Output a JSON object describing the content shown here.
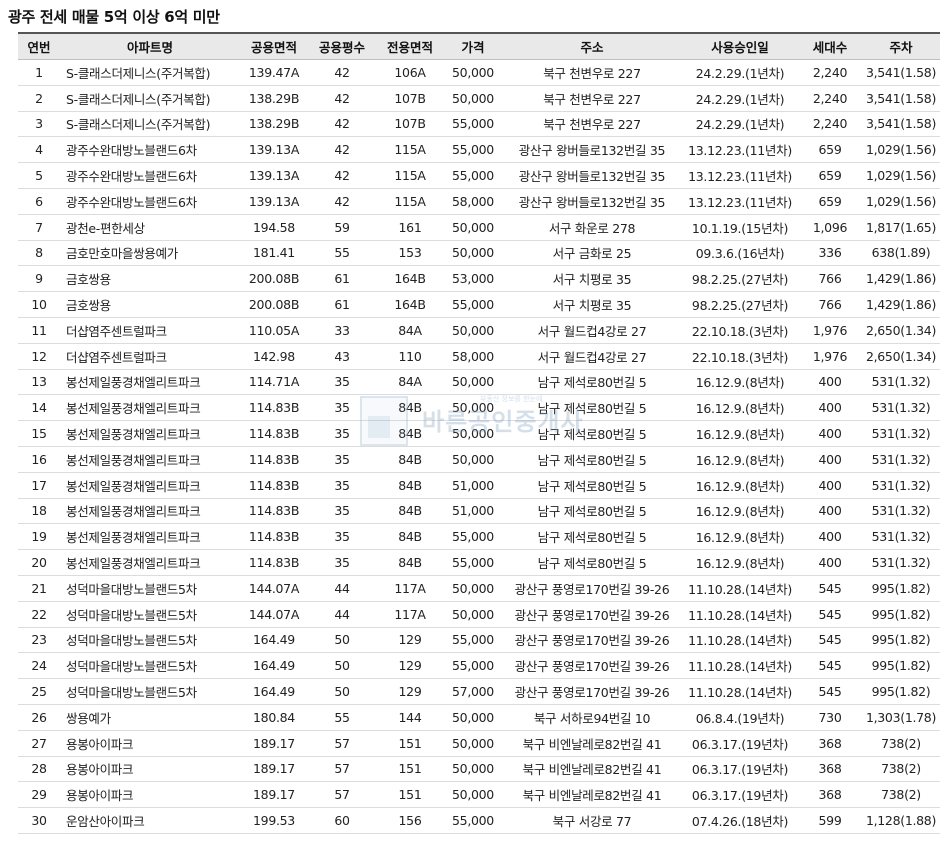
{
  "title": "광주 전세 매물 5억 이상 6억 미만",
  "headers": [
    "연번",
    "아파트명",
    "공용면적",
    "공용평수",
    "전용면적",
    "가격",
    "주소",
    "사용승인일",
    "세대수",
    "주차"
  ],
  "watermark": {
    "text": "바른공인중개사",
    "sub": "부동산 정보를 한눈에"
  },
  "rows": [
    {
      "no": "1",
      "name": "S-클래스더제니스(주거복합)",
      "area": "139.47A",
      "pyeong": "42",
      "exclusive": "106A",
      "price": "50,000",
      "addr": "북구 천변우로 227",
      "approved": "24.2.29.(1년차)",
      "households": "2,240",
      "parking": "3,541(1.58)"
    },
    {
      "no": "2",
      "name": "S-클래스더제니스(주거복합)",
      "area": "138.29B",
      "pyeong": "42",
      "exclusive": "107B",
      "price": "50,000",
      "addr": "북구 천변우로 227",
      "approved": "24.2.29.(1년차)",
      "households": "2,240",
      "parking": "3,541(1.58)"
    },
    {
      "no": "3",
      "name": "S-클래스더제니스(주거복합)",
      "area": "138.29B",
      "pyeong": "42",
      "exclusive": "107B",
      "price": "55,000",
      "addr": "북구 천변우로 227",
      "approved": "24.2.29.(1년차)",
      "households": "2,240",
      "parking": "3,541(1.58)"
    },
    {
      "no": "4",
      "name": "광주수완대방노블랜드6차",
      "area": "139.13A",
      "pyeong": "42",
      "exclusive": "115A",
      "price": "55,000",
      "addr": "광산구 왕버들로132번길 35",
      "approved": "13.12.23.(11년차)",
      "households": "659",
      "parking": "1,029(1.56)"
    },
    {
      "no": "5",
      "name": "광주수완대방노블랜드6차",
      "area": "139.13A",
      "pyeong": "42",
      "exclusive": "115A",
      "price": "55,000",
      "addr": "광산구 왕버들로132번길 35",
      "approved": "13.12.23.(11년차)",
      "households": "659",
      "parking": "1,029(1.56)"
    },
    {
      "no": "6",
      "name": "광주수완대방노블랜드6차",
      "area": "139.13A",
      "pyeong": "42",
      "exclusive": "115A",
      "price": "58,000",
      "addr": "광산구 왕버들로132번길 35",
      "approved": "13.12.23.(11년차)",
      "households": "659",
      "parking": "1,029(1.56)"
    },
    {
      "no": "7",
      "name": "광천e-편한세상",
      "area": "194.58",
      "pyeong": "59",
      "exclusive": "161",
      "price": "50,000",
      "addr": "서구 화운로 278",
      "approved": "10.1.19.(15년차)",
      "households": "1,096",
      "parking": "1,817(1.65)"
    },
    {
      "no": "8",
      "name": "금호만호마을쌍용예가",
      "area": "181.41",
      "pyeong": "55",
      "exclusive": "153",
      "price": "50,000",
      "addr": "서구 금화로 25",
      "approved": "09.3.6.(16년차)",
      "households": "336",
      "parking": "638(1.89)"
    },
    {
      "no": "9",
      "name": "금호쌍용",
      "area": "200.08B",
      "pyeong": "61",
      "exclusive": "164B",
      "price": "53,000",
      "addr": "서구 치평로 35",
      "approved": "98.2.25.(27년차)",
      "households": "766",
      "parking": "1,429(1.86)"
    },
    {
      "no": "10",
      "name": "금호쌍용",
      "area": "200.08B",
      "pyeong": "61",
      "exclusive": "164B",
      "price": "55,000",
      "addr": "서구 치평로 35",
      "approved": "98.2.25.(27년차)",
      "households": "766",
      "parking": "1,429(1.86)"
    },
    {
      "no": "11",
      "name": "더샵염주센트럴파크",
      "area": "110.05A",
      "pyeong": "33",
      "exclusive": "84A",
      "price": "50,000",
      "addr": "서구 월드컵4강로 27",
      "approved": "22.10.18.(3년차)",
      "households": "1,976",
      "parking": "2,650(1.34)"
    },
    {
      "no": "12",
      "name": "더샵염주센트럴파크",
      "area": "142.98",
      "pyeong": "43",
      "exclusive": "110",
      "price": "58,000",
      "addr": "서구 월드컵4강로 27",
      "approved": "22.10.18.(3년차)",
      "households": "1,976",
      "parking": "2,650(1.34)"
    },
    {
      "no": "13",
      "name": "봉선제일풍경채엘리트파크",
      "area": "114.71A",
      "pyeong": "35",
      "exclusive": "84A",
      "price": "50,000",
      "addr": "남구 제석로80번길 5",
      "approved": "16.12.9.(8년차)",
      "households": "400",
      "parking": "531(1.32)"
    },
    {
      "no": "14",
      "name": "봉선제일풍경채엘리트파크",
      "area": "114.83B",
      "pyeong": "35",
      "exclusive": "84B",
      "price": "50,000",
      "addr": "남구 제석로80번길 5",
      "approved": "16.12.9.(8년차)",
      "households": "400",
      "parking": "531(1.32)"
    },
    {
      "no": "15",
      "name": "봉선제일풍경채엘리트파크",
      "area": "114.83B",
      "pyeong": "35",
      "exclusive": "84B",
      "price": "50,000",
      "addr": "남구 제석로80번길 5",
      "approved": "16.12.9.(8년차)",
      "households": "400",
      "parking": "531(1.32)"
    },
    {
      "no": "16",
      "name": "봉선제일풍경채엘리트파크",
      "area": "114.83B",
      "pyeong": "35",
      "exclusive": "84B",
      "price": "50,000",
      "addr": "남구 제석로80번길 5",
      "approved": "16.12.9.(8년차)",
      "households": "400",
      "parking": "531(1.32)"
    },
    {
      "no": "17",
      "name": "봉선제일풍경채엘리트파크",
      "area": "114.83B",
      "pyeong": "35",
      "exclusive": "84B",
      "price": "51,000",
      "addr": "남구 제석로80번길 5",
      "approved": "16.12.9.(8년차)",
      "households": "400",
      "parking": "531(1.32)"
    },
    {
      "no": "18",
      "name": "봉선제일풍경채엘리트파크",
      "area": "114.83B",
      "pyeong": "35",
      "exclusive": "84B",
      "price": "51,000",
      "addr": "남구 제석로80번길 5",
      "approved": "16.12.9.(8년차)",
      "households": "400",
      "parking": "531(1.32)"
    },
    {
      "no": "19",
      "name": "봉선제일풍경채엘리트파크",
      "area": "114.83B",
      "pyeong": "35",
      "exclusive": "84B",
      "price": "55,000",
      "addr": "남구 제석로80번길 5",
      "approved": "16.12.9.(8년차)",
      "households": "400",
      "parking": "531(1.32)"
    },
    {
      "no": "20",
      "name": "봉선제일풍경채엘리트파크",
      "area": "114.83B",
      "pyeong": "35",
      "exclusive": "84B",
      "price": "55,000",
      "addr": "남구 제석로80번길 5",
      "approved": "16.12.9.(8년차)",
      "households": "400",
      "parking": "531(1.32)"
    },
    {
      "no": "21",
      "name": "성덕마을대방노블랜드5차",
      "area": "144.07A",
      "pyeong": "44",
      "exclusive": "117A",
      "price": "50,000",
      "addr": "광산구 풍영로170번길 39-26",
      "approved": "11.10.28.(14년차)",
      "households": "545",
      "parking": "995(1.82)"
    },
    {
      "no": "22",
      "name": "성덕마을대방노블랜드5차",
      "area": "144.07A",
      "pyeong": "44",
      "exclusive": "117A",
      "price": "50,000",
      "addr": "광산구 풍영로170번길 39-26",
      "approved": "11.10.28.(14년차)",
      "households": "545",
      "parking": "995(1.82)"
    },
    {
      "no": "23",
      "name": "성덕마을대방노블랜드5차",
      "area": "164.49",
      "pyeong": "50",
      "exclusive": "129",
      "price": "55,000",
      "addr": "광산구 풍영로170번길 39-26",
      "approved": "11.10.28.(14년차)",
      "households": "545",
      "parking": "995(1.82)"
    },
    {
      "no": "24",
      "name": "성덕마을대방노블랜드5차",
      "area": "164.49",
      "pyeong": "50",
      "exclusive": "129",
      "price": "55,000",
      "addr": "광산구 풍영로170번길 39-26",
      "approved": "11.10.28.(14년차)",
      "households": "545",
      "parking": "995(1.82)"
    },
    {
      "no": "25",
      "name": "성덕마을대방노블랜드5차",
      "area": "164.49",
      "pyeong": "50",
      "exclusive": "129",
      "price": "57,000",
      "addr": "광산구 풍영로170번길 39-26",
      "approved": "11.10.28.(14년차)",
      "households": "545",
      "parking": "995(1.82)"
    },
    {
      "no": "26",
      "name": "쌍용예가",
      "area": "180.84",
      "pyeong": "55",
      "exclusive": "144",
      "price": "50,000",
      "addr": "북구 서하로94번길 10",
      "approved": "06.8.4.(19년차)",
      "households": "730",
      "parking": "1,303(1.78)"
    },
    {
      "no": "27",
      "name": "용봉아이파크",
      "area": "189.17",
      "pyeong": "57",
      "exclusive": "151",
      "price": "50,000",
      "addr": "북구 비엔날레로82번길 41",
      "approved": "06.3.17.(19년차)",
      "households": "368",
      "parking": "738(2)"
    },
    {
      "no": "28",
      "name": "용봉아이파크",
      "area": "189.17",
      "pyeong": "57",
      "exclusive": "151",
      "price": "50,000",
      "addr": "북구 비엔날레로82번길 41",
      "approved": "06.3.17.(19년차)",
      "households": "368",
      "parking": "738(2)"
    },
    {
      "no": "29",
      "name": "용봉아이파크",
      "area": "189.17",
      "pyeong": "57",
      "exclusive": "151",
      "price": "50,000",
      "addr": "북구 비엔날레로82번길 41",
      "approved": "06.3.17.(19년차)",
      "households": "368",
      "parking": "738(2)"
    },
    {
      "no": "30",
      "name": "운암산아이파크",
      "area": "199.53",
      "pyeong": "60",
      "exclusive": "156",
      "price": "55,000",
      "addr": "북구 서강로 77",
      "approved": "07.4.26.(18년차)",
      "households": "599",
      "parking": "1,128(1.88)"
    }
  ]
}
